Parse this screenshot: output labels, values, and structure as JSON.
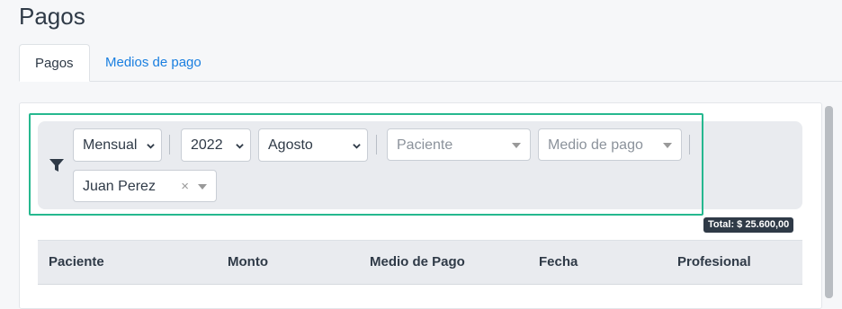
{
  "page": {
    "title": "Pagos"
  },
  "tabs": [
    {
      "label": "Pagos",
      "active": true
    },
    {
      "label": "Medios de pago",
      "active": false
    }
  ],
  "filters": {
    "period": {
      "value": "Mensual"
    },
    "year": {
      "value": "2022"
    },
    "month": {
      "value": "Agosto"
    },
    "patient": {
      "placeholder": "Paciente"
    },
    "payment_method": {
      "placeholder": "Medio de pago"
    },
    "professional": {
      "value": "Juan Perez",
      "clear_glyph": "×"
    }
  },
  "summary": {
    "total": "Total: $ 25.600,00"
  },
  "table": {
    "columns": [
      "Paciente",
      "Monto",
      "Medio de Pago",
      "Fecha",
      "Profesional"
    ]
  },
  "colors": {
    "highlight": "#26b88f",
    "link": "#1a7fe0",
    "badge": "#2f3a47"
  }
}
